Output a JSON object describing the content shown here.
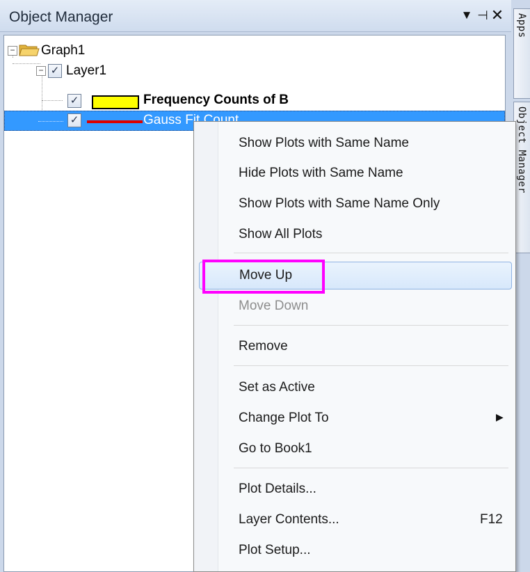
{
  "panel": {
    "title": "Object Manager",
    "controls": {
      "dropdown": "▼",
      "pin": "⊣",
      "close": "✕"
    }
  },
  "tree": {
    "graph_label": "Graph1",
    "layer_label": "Layer1",
    "plots": [
      {
        "label": "Frequency Counts of B",
        "checked": true,
        "swatch": "#ffff00",
        "bold": true
      },
      {
        "label": "Gauss Fit Count",
        "checked": true,
        "swatch": "#dd0000",
        "selected": true
      }
    ],
    "expander_symbol": "−",
    "check_symbol": "✓"
  },
  "side_tabs": [
    "Apps",
    "Object Manager"
  ],
  "context_menu": {
    "groups": [
      [
        {
          "label": "Show Plots with Same Name"
        },
        {
          "label": "Hide Plots with Same Name"
        },
        {
          "label": "Show Plots with Same Name Only"
        },
        {
          "label": "Show All Plots"
        }
      ],
      [
        {
          "label": "Move Up",
          "highlighted": true
        },
        {
          "label": "Move Down",
          "disabled": true
        }
      ],
      [
        {
          "label": "Remove"
        }
      ],
      [
        {
          "label": "Set as Active"
        },
        {
          "label": "Change Plot To",
          "submenu": true,
          "arrow": "▶"
        },
        {
          "label": "Go to Book1"
        }
      ],
      [
        {
          "label": "Plot Details..."
        },
        {
          "label": "Layer Contents...",
          "shortcut": "F12"
        },
        {
          "label": "Plot Setup..."
        }
      ]
    ]
  },
  "colors": {
    "selection": "#3399ff",
    "annotation": "#ff00ff",
    "menu_highlight_border": "#8db2e3"
  }
}
